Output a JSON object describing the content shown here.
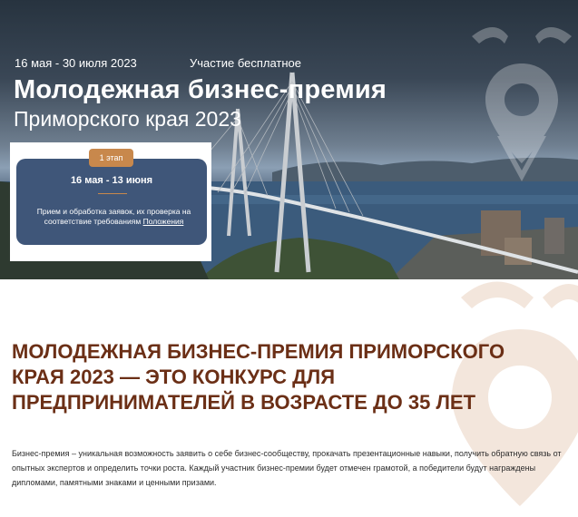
{
  "hero": {
    "dates": "16 мая - 30 июля 2023",
    "free": "Участие бесплатное",
    "title": "Молодежная бизнес-премия",
    "subtitle": "Приморского края 2023"
  },
  "stage": {
    "badge": "1 этап",
    "dates": "16 мая - 13 июня",
    "text": "Прием и обработка заявок, их проверка на соответствие требованиям",
    "link": "Положения"
  },
  "content": {
    "headline": "Молодежная бизнес-премия Приморского края 2023 — это конкурс для предпринимателей в возрасте до 35 лет",
    "body": "Бизнес-премия – уникальная возможность заявить о себе бизнес-сообществу, прокачать презентационные навыки, получить обратную связь от опытных экспертов и определить точки роста. Каждый участник бизнес-премии будет отмечен грамотой, а победители будут награждены дипломами, памятными знаками и ценными призами."
  },
  "colors": {
    "accent": "#c8884c",
    "card": "#3f5679",
    "headline": "#6b2f16"
  }
}
